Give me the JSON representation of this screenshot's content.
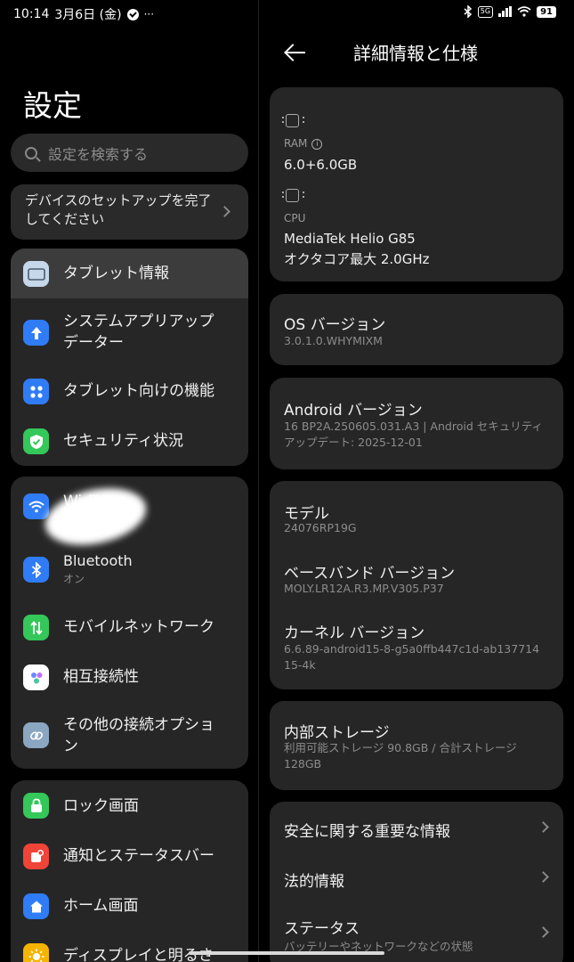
{
  "status_bar": {
    "time": "10:14",
    "date": "3月6日 (金)",
    "more": "···",
    "battery": "91",
    "network_badge": "5G"
  },
  "left": {
    "title": "設定",
    "search_placeholder": "設定を検索する",
    "setup_card": "デバイスのセットアップを完了してください",
    "group1": [
      {
        "label": "タブレット情報",
        "icon": "tablet-icon",
        "color": "#c7d7ea"
      },
      {
        "label": "システムアプリアップデーター",
        "icon": "arrow-up-icon",
        "color": "#2f7cf6"
      },
      {
        "label": "タブレット向けの機能",
        "icon": "grid-icon",
        "color": "#2f7cf6"
      },
      {
        "label": "セキュリティ状況",
        "icon": "shield-check-icon",
        "color": "#34c759"
      }
    ],
    "group2": [
      {
        "label": "Wi-Fi",
        "icon": "wifi-icon",
        "color": "#2f7cf6"
      },
      {
        "label": "Bluetooth",
        "sub": "オン",
        "icon": "bluetooth-icon",
        "color": "#2f7cf6"
      },
      {
        "label": "モバイルネットワーク",
        "icon": "mobile-data-icon",
        "color": "#34c759"
      },
      {
        "label": "相互接続性",
        "icon": "interconnect-icon",
        "color": "#ffffff"
      },
      {
        "label": "その他の接続オプション",
        "icon": "link-icon",
        "color": "#8aa6c0"
      }
    ],
    "group3": [
      {
        "label": "ロック画面",
        "icon": "lock-icon",
        "color": "#34c759"
      },
      {
        "label": "通知とステータスバー",
        "icon": "notification-icon",
        "color": "#f04438"
      },
      {
        "label": "ホーム画面",
        "icon": "home-icon",
        "color": "#2f7cf6"
      },
      {
        "label": "ディスプレイと明るさ",
        "icon": "sun-icon",
        "color": "#f5b400"
      }
    ]
  },
  "right": {
    "title": "詳細情報と仕様",
    "ram_label": "RAM",
    "ram_value": "6.0+6.0GB",
    "cpu_label": "CPU",
    "cpu_value_1": "MediaTek Helio G85",
    "cpu_value_2": "オクタコア最大 2.0GHz",
    "os_label": "OS バージョン",
    "os_value": "3.0.1.0.WHYMIXM",
    "android_label": "Android バージョン",
    "android_value": "16 BP2A.250605.031.A3 | Android セキュリティアップデート: 2025-12-01",
    "model_label": "モデル",
    "model_value": "24076RP19G",
    "baseband_label": "ベースバンド バージョン",
    "baseband_value": "MOLY.LR12A.R3.MP.V305.P37",
    "kernel_label": "カーネル バージョン",
    "kernel_value": "6.6.89-android15-8-g5a0ffb447c1d-ab13771415-4k",
    "storage_label": "内部ストレージ",
    "storage_value": "利用可能ストレージ 90.8GB / 合計ストレージ 128GB",
    "safety_label": "安全に関する重要な情報",
    "legal_label": "法的情報",
    "status_label": "ステータス",
    "status_sub": "バッテリーやネットワークなどの状態"
  }
}
